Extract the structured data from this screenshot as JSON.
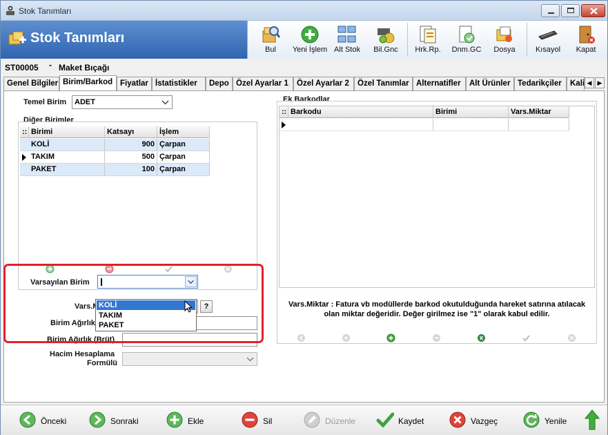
{
  "window": {
    "title": "Stok Tanımları"
  },
  "header": {
    "title": "Stok Tanımları"
  },
  "toolbar": {
    "buttons": [
      {
        "label": "Bul",
        "icon": "search-box-icon"
      },
      {
        "label": "Yeni İşlem",
        "icon": "add-icon"
      },
      {
        "label": "Alt Stok",
        "icon": "substock-icon"
      },
      {
        "label": "Bil.Gnc",
        "icon": "update-icon"
      },
      {
        "label": "Hrk.Rp.",
        "icon": "report-icon"
      },
      {
        "label": "Dnm.GC",
        "icon": "period-icon"
      },
      {
        "label": "Dosya",
        "icon": "file-icon"
      },
      {
        "label": "Kısayol",
        "icon": "keyboard-icon"
      },
      {
        "label": "Kapat",
        "icon": "exit-door-icon"
      }
    ]
  },
  "record": {
    "code": "ST00005",
    "separator": "-",
    "name": "Maket Bıçağı"
  },
  "tabs": [
    "Genel Bilgiler",
    "Birim/Barkod",
    "Fiyatlar",
    "İstatistikler",
    "Depo",
    "Özel Ayarlar 1",
    "Özel Ayarlar 2",
    "Özel Tanımlar",
    "Alternatifler",
    "Alt Ürünler",
    "Tedarikçiler",
    "Kali"
  ],
  "form": {
    "temel_birim_label": "Temel Birim",
    "temel_birim_value": "ADET",
    "diger_birimler_title": "Diğer Birimler",
    "varsayilan_birim_label": "Varsayılan Birim",
    "varsayilan_birim_value": "",
    "vars_miktar_label": "Vars.Miktar",
    "birim_agirlik_label": "Birim Ağırlık",
    "birim_agirlik_brut_label": "Birim Ağırlık (Brüt)",
    "hacim_label_line1": "Hacim Hesaplama",
    "hacim_label_line2": "Formülü",
    "help_label": "?"
  },
  "units_grid": {
    "columns": [
      "Birimi",
      "Katsayı",
      "İşlem"
    ],
    "rows": [
      {
        "birimi": "KOLİ",
        "katsayi": "900",
        "islem": "Çarpan"
      },
      {
        "birimi": "TAKIM",
        "katsayi": "500",
        "islem": "Çarpan"
      },
      {
        "birimi": "PAKET",
        "katsayi": "100",
        "islem": "Çarpan"
      }
    ]
  },
  "dropdown_options": [
    "KOLİ",
    "TAKIM",
    "PAKET"
  ],
  "barcodes": {
    "title": "Ek Barkodlar",
    "columns": [
      "Barkodu",
      "Birimi",
      "Vars.Miktar"
    ],
    "info": "Vars.Miktar : Fatura vb modüllerde barkod okutulduğunda hareket satırına atılacak olan miktar değeridir. Değer girilmez ise \"1\" olarak kabul edilir."
  },
  "bottom": {
    "buttons": [
      {
        "label": "Önceki",
        "icon": "previous-icon"
      },
      {
        "label": "Sonraki",
        "icon": "next-icon"
      },
      {
        "label": "Ekle",
        "icon": "add-icon"
      },
      {
        "label": "Sil",
        "icon": "delete-icon"
      },
      {
        "label": "Düzenle",
        "icon": "edit-icon"
      },
      {
        "label": "Kaydet",
        "icon": "save-check-icon"
      },
      {
        "label": "Vazgeç",
        "icon": "cancel-icon"
      },
      {
        "label": "Yenile",
        "icon": "refresh-icon"
      }
    ]
  },
  "colors": {
    "header_blue": "#2f64b0",
    "grid_alt_row": "#dce9f8",
    "selection": "#3377d0",
    "highlight_box": "#e0202a"
  }
}
